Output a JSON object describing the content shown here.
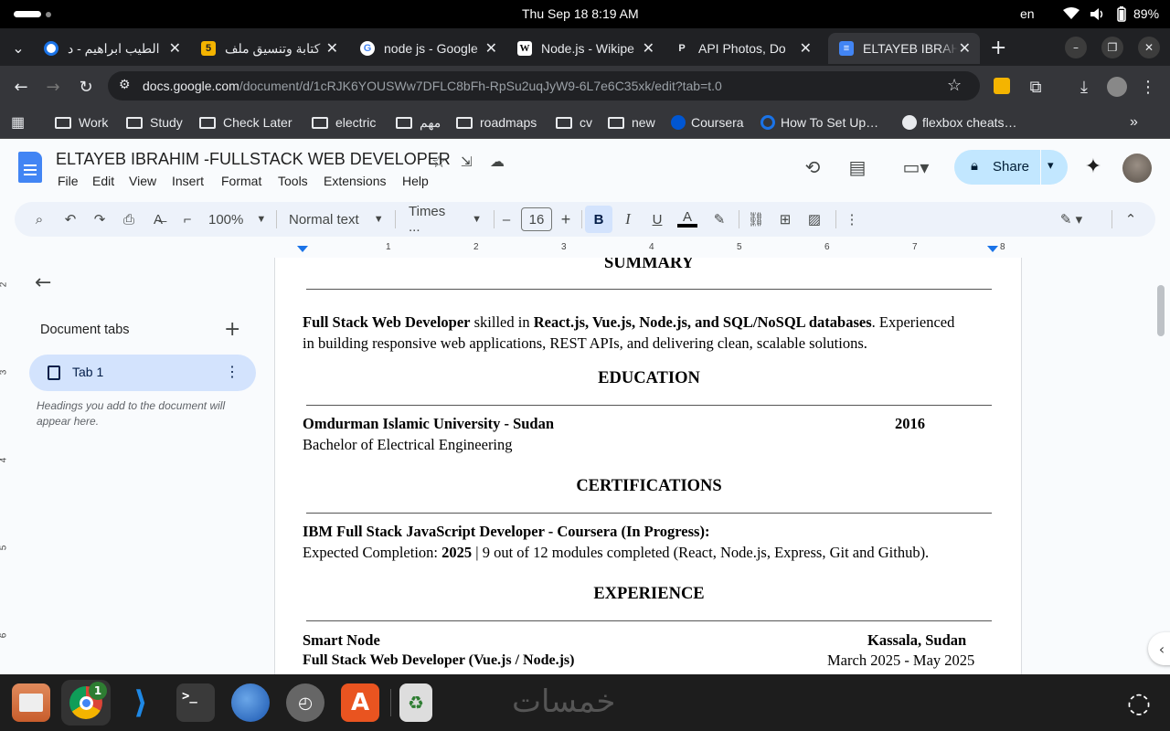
{
  "system_bar": {
    "datetime": "Thu Sep 18    8:19 AM",
    "language": "en",
    "battery": "89%"
  },
  "tabs": [
    {
      "title": "الطيب ابراهيم - د",
      "favicon": "G",
      "active": false
    },
    {
      "title": "كتابة وتنسيق ملف",
      "favicon": "5",
      "active": false
    },
    {
      "title": "node js - Google",
      "favicon": "G",
      "active": false
    },
    {
      "title": "Node.js - Wikipe",
      "favicon": "W",
      "active": false
    },
    {
      "title": "API Photos, Do",
      "favicon": "P",
      "active": false
    },
    {
      "title": "ELTAYEB IBRAHI",
      "favicon": "≡",
      "active": true
    }
  ],
  "address": {
    "domain": "docs.google.com",
    "path": "/document/d/1cRJK6YOUSWw7DFLC8bFh-RpSu2uqJyW9-6L7e6C35xk/edit?tab=t.0"
  },
  "bookmarks": [
    "Work",
    "Study",
    "Check Later",
    "electric",
    "مهم",
    "roadmaps",
    "cv",
    "new",
    "Coursera",
    "How To Set Up…",
    "flexbox cheats…"
  ],
  "doc": {
    "title": "ELTAYEB IBRAHIM -FULLSTACK WEB DEVELOPER",
    "menus": [
      "File",
      "Edit",
      "View",
      "Insert",
      "Format",
      "Tools",
      "Extensions",
      "Help"
    ],
    "share_label": "Share"
  },
  "toolbar": {
    "zoom": "100%",
    "style": "Normal text",
    "font": "Times ...",
    "font_size": "16"
  },
  "ruler": [
    "1",
    "2",
    "3",
    "4",
    "5",
    "6",
    "7",
    "8"
  ],
  "vruler": [
    "2",
    "3",
    "4",
    "5",
    "6"
  ],
  "side_panel": {
    "heading": "Document tabs",
    "tab_label": "Tab 1",
    "hint": "Headings you add to the document will appear here."
  },
  "page": {
    "summary_heading": "SUMMARY",
    "summary_b1": "Full Stack Web Developer",
    "summary_t1": " skilled in ",
    "summary_b2": "React.js, Vue.js, Node.js, and SQL/NoSQL databases",
    "summary_t2": ". Experienced",
    "summary_line2": "in building responsive web applications, REST APIs, and delivering clean, scalable solutions.",
    "education_heading": "EDUCATION",
    "edu_school": "Omdurman Islamic University - Sudan",
    "edu_year": "2016",
    "edu_degree": "Bachelor of Electrical Engineering",
    "cert_heading": "CERTIFICATIONS",
    "cert_title": "IBM Full Stack JavaScript Developer - Coursera (In Progress):",
    "cert_t1": "Expected Completion: ",
    "cert_b1": "2025",
    "cert_t2": " | 9 out of 12 modules completed (React, Node.js, Express, Git and Github).",
    "exp_heading": "EXPERIENCE",
    "exp_company": "Smart Node",
    "exp_location": "Kassala, Sudan",
    "exp_role": "Full Stack Web Developer (Vue.js / Node.js)",
    "exp_dates": "March 2025 - May 2025"
  },
  "dock": {
    "chrome_badge": "1",
    "watermark": "خمسات"
  }
}
